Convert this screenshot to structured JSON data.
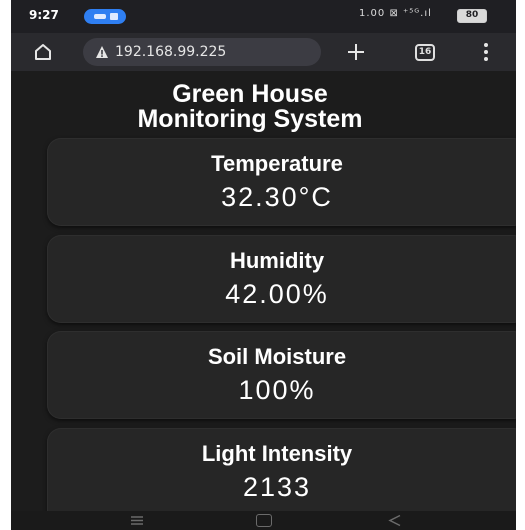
{
  "status_bar": {
    "time": "9:27",
    "right_indicators": "1.00 ⊠ ⁺⁵ᴳ.ıl",
    "battery": "80"
  },
  "browser": {
    "url": "192.168.99.225",
    "tab_count": "16",
    "icons": {
      "home": "home-icon",
      "security_warning": "warning-triangle-icon",
      "new_tab": "plus-icon",
      "tabs": "tab-switcher-icon",
      "menu": "kebab-menu-icon"
    }
  },
  "page": {
    "title_line1": "Green House",
    "title_line2": "Monitoring System",
    "cards": [
      {
        "label": "Temperature",
        "value": "32.30°C"
      },
      {
        "label": "Humidity",
        "value": "42.00%"
      },
      {
        "label": "Soil Moisture",
        "value": "100%"
      },
      {
        "label": "Light Intensity",
        "value": "2133"
      }
    ]
  },
  "colors": {
    "background": "#1c1c1c",
    "card": "#262626",
    "text": "#ffffff",
    "status_accent": "#2f7ff2"
  }
}
